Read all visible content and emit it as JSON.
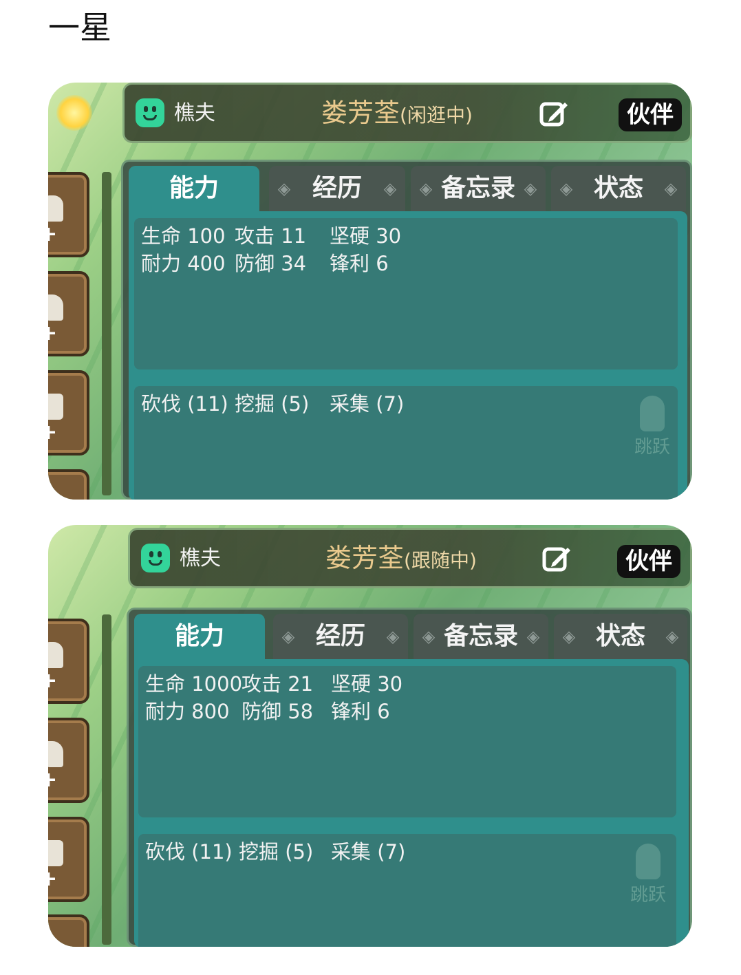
{
  "page_title": "一星",
  "cards": [
    {
      "job": "樵夫",
      "name": "娄芳荃",
      "status": "(闲逛中)",
      "partner": "伙伴",
      "tabs": [
        "能力",
        "经历",
        "备忘录",
        "状态"
      ],
      "stats_row1": [
        "生命 100",
        "攻击 11",
        "坚硬 30"
      ],
      "stats_row2": [
        "耐力 400",
        "防御 34",
        "锋利 6"
      ],
      "skills": [
        "砍伐 (11)",
        "挖掘 (5)",
        "采集 (7)"
      ],
      "watermark": "跳跃"
    },
    {
      "job": "樵夫",
      "name": "娄芳荃",
      "status": "(跟随中)",
      "partner": "伙伴",
      "tabs": [
        "能力",
        "经历",
        "备忘录",
        "状态"
      ],
      "stats_row1": [
        "生命 1000",
        "攻击 21",
        "坚硬 30"
      ],
      "stats_row2": [
        "耐力 800",
        "防御 58",
        "锋利 6"
      ],
      "skills": [
        "砍伐 (11)",
        "挖掘 (5)",
        "采集 (7)"
      ],
      "watermark": "跳跃"
    }
  ],
  "colors": {
    "job_badge": "#33d49a",
    "name_gold": "#e9c98d",
    "tab_active": "#2f8f8c",
    "tab_inactive": "#4a5650",
    "stats_bg": "#367a76",
    "partner_bg": "#111111"
  },
  "icons": {
    "job": "smiley-badge-icon",
    "edit": "edit-pencil-icon",
    "slot_plus": "plus-icon"
  }
}
